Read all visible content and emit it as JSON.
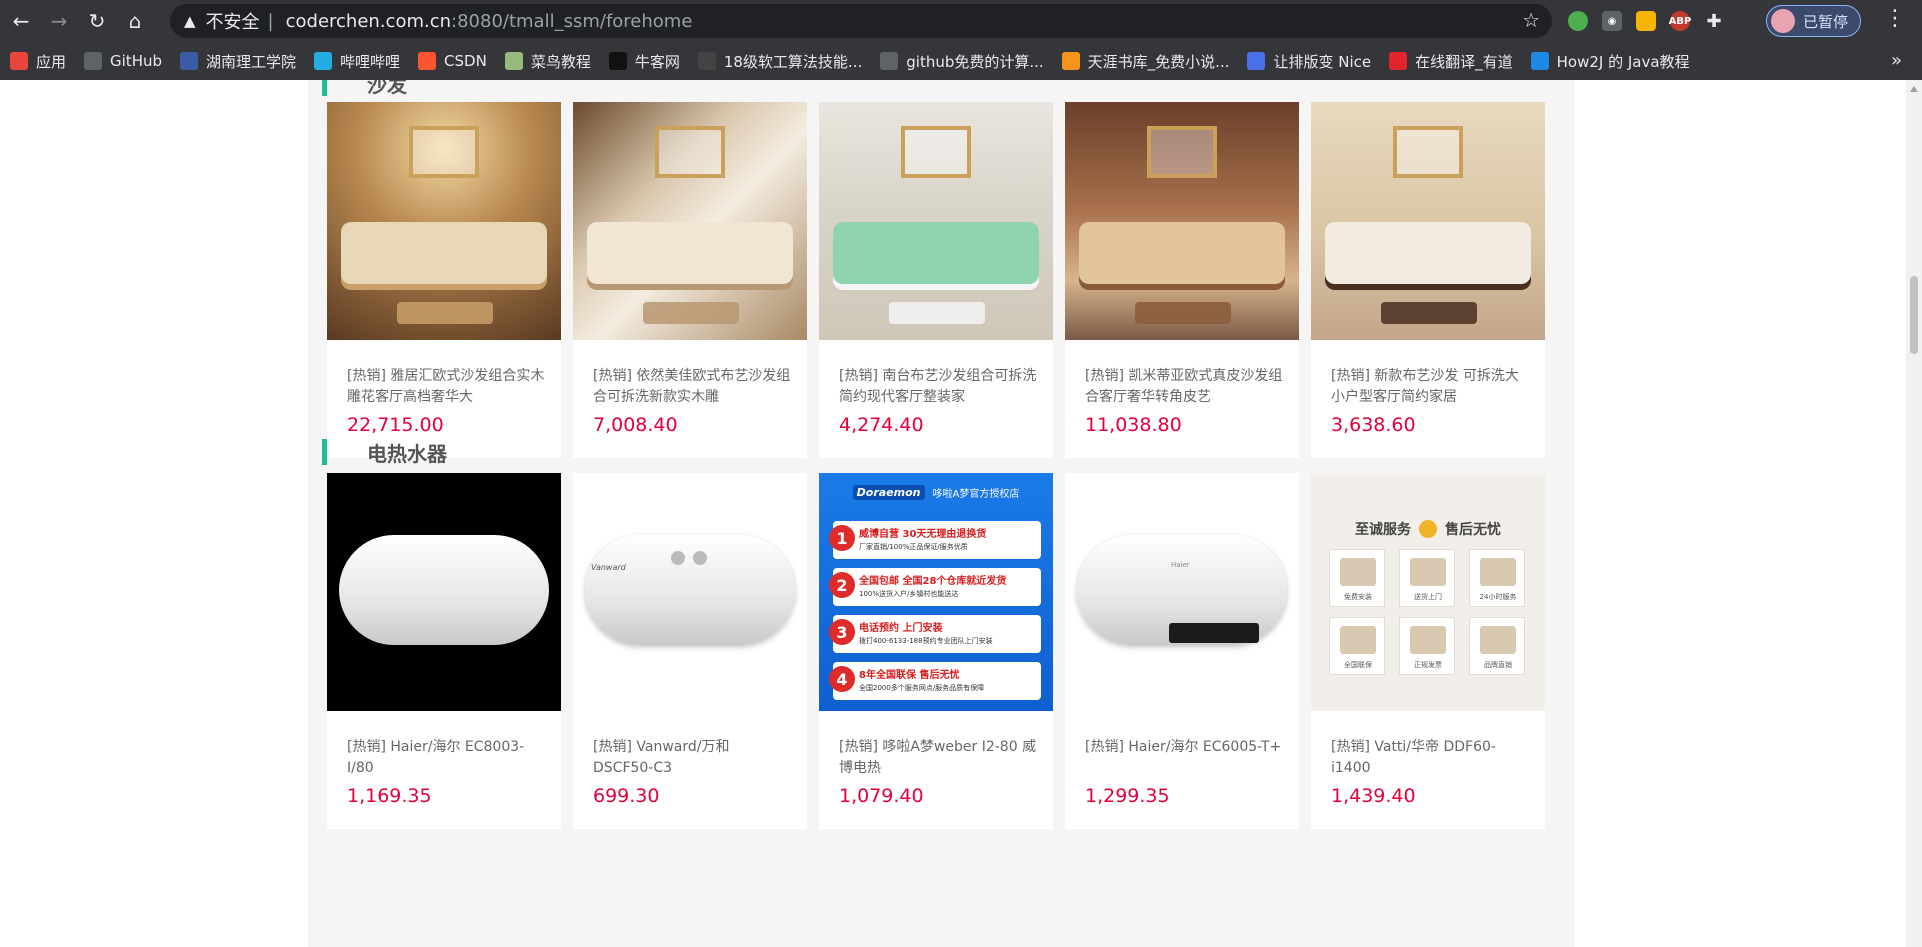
{
  "browser": {
    "omnibox": {
      "warning_icon": "warning-triangle-icon",
      "insecure_label": "不安全",
      "separator": "|",
      "host": "coderchen.com.cn",
      "path": ":8080/tmall_ssm/forehome"
    },
    "profile_label": "已暂停",
    "bookmarks": [
      {
        "label": "应用",
        "icon": "apps-grid-icon",
        "color": "#e8453c"
      },
      {
        "label": "GitHub",
        "icon": "github-icon",
        "color": "#5f6368"
      },
      {
        "label": "湖南理工学院",
        "icon": "school-icon",
        "color": "#3b5ba5"
      },
      {
        "label": "哔哩哔哩",
        "icon": "bilibili-icon",
        "color": "#23ade5"
      },
      {
        "label": "CSDN",
        "icon": "csdn-icon",
        "color": "#fc5531"
      },
      {
        "label": "菜鸟教程",
        "icon": "runoob-icon",
        "color": "#96b97d"
      },
      {
        "label": "牛客网",
        "icon": "nowcoder-icon",
        "color": "#111111"
      },
      {
        "label": "18级软工算法技能...",
        "icon": "course-icon",
        "color": "#444444"
      },
      {
        "label": "github免费的计算...",
        "icon": "github-icon",
        "color": "#5f6368"
      },
      {
        "label": "天涯书库_免费小说...",
        "icon": "tianya-icon",
        "color": "#f7941d"
      },
      {
        "label": "让排版变 Nice",
        "icon": "mdnice-icon",
        "color": "#4a72e8"
      },
      {
        "label": "在线翻译_有道",
        "icon": "youdao-icon",
        "color": "#e3242b"
      },
      {
        "label": "How2J 的 Java教程",
        "icon": "how2j-icon",
        "color": "#1e88e5"
      }
    ]
  },
  "sections": [
    {
      "title": "沙发",
      "products": [
        {
          "name": "[热销] 雅居汇欧式沙发组合实木雕花客厅高档奢华大",
          "price": "22,715.00",
          "image": "sofa-european-living-room"
        },
        {
          "name": "[热销] 依然美佳欧式布艺沙发组合可拆洗新款实木雕",
          "price": "7,008.40",
          "image": "sofa-carved-detail"
        },
        {
          "name": "[热销] 南台布艺沙发组合可拆洗简约现代客厅整装家",
          "price": "4,274.40",
          "image": "sofa-green-sectional"
        },
        {
          "name": "[热销] 凯米蒂亚欧式真皮沙发组合客厅奢华转角皮艺",
          "price": "11,038.80",
          "image": "sofa-leather-corner"
        },
        {
          "name": "[热销] 新款布艺沙发 可拆洗大小户型客厅简约家居",
          "price": "3,638.60",
          "image": "sofa-cream-sectional"
        }
      ]
    },
    {
      "title": "电热水器",
      "products": [
        {
          "name": "[热销] Haier/海尔 EC8003-I/80",
          "price": "1,169.35",
          "image": "heater-white-black-bg"
        },
        {
          "name": "[热销] Vanward/万和 DSCF50-C3",
          "price": "699.30",
          "image": "heater-vanward"
        },
        {
          "name": "[热销] 哆啦A梦weber I2-80 威博电热",
          "price": "1,079.40",
          "image": "heater-doraemon-promo"
        },
        {
          "name": "[热销] Haier/海尔 EC6005-T+",
          "price": "1,299.35",
          "image": "heater-haier-display"
        },
        {
          "name": "[热销] Vatti/华帝 DDF60-i1400",
          "price": "1,439.40",
          "image": "heater-vatti-service"
        }
      ]
    }
  ],
  "promo_images": {
    "doraemon": {
      "brand": "Doraemon",
      "store": "哆啦A梦官方授权店",
      "lines": [
        {
          "num": "1",
          "title": "威博自营 30天无理由退换货",
          "sub": "厂家直销/100%正品保证/服务优质"
        },
        {
          "num": "2",
          "title": "全国包邮 全国28个仓库就近发货",
          "sub": "100%送货入户/乡镇村也能送达"
        },
        {
          "num": "3",
          "title": "电话预约 上门安装",
          "sub": "拨打400-6133-188预约专业团队上门安装"
        },
        {
          "num": "4",
          "title": "8年全国联保 售后无忧",
          "sub": "全国2000多个服务网点/服务品质有保障"
        }
      ]
    },
    "vatti": {
      "headline_a": "至诚服务",
      "headline_b": "售后无忧",
      "tiles": [
        "免费安装",
        "送货上门",
        "24小时服务",
        "全国联保",
        "正规发票",
        "品牌直销"
      ]
    },
    "vanward_logo": "Vanward",
    "haier_logo": "Haier"
  }
}
